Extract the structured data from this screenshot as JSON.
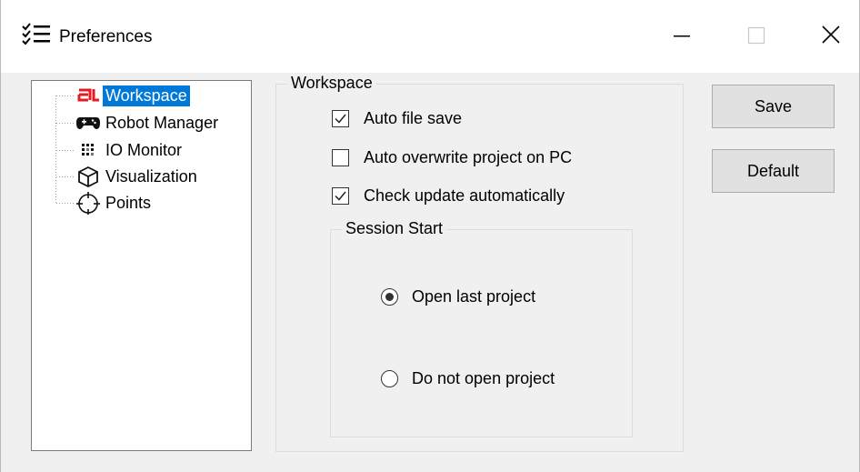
{
  "window": {
    "title": "Preferences",
    "icon": "list-settings-icon",
    "controls": {
      "minimize": "minimize-icon",
      "maximize": "maximize-icon",
      "close": "close-icon"
    }
  },
  "tree": {
    "items": [
      {
        "label": "Workspace",
        "icon": "workspace-logo-icon",
        "selected": true
      },
      {
        "label": "Robot Manager",
        "icon": "gamepad-icon",
        "selected": false
      },
      {
        "label": "IO Monitor",
        "icon": "io-grid-icon",
        "selected": false
      },
      {
        "label": "Visualization",
        "icon": "cube-icon",
        "selected": false
      },
      {
        "label": "Points",
        "icon": "crosshair-icon",
        "selected": false
      }
    ]
  },
  "workspace": {
    "legend": "Workspace",
    "options": [
      {
        "label": "Auto file save",
        "checked": true
      },
      {
        "label": "Auto overwrite project on PC",
        "checked": false
      },
      {
        "label": "Check update automatically",
        "checked": true
      }
    ],
    "session_start": {
      "legend": "Session Start",
      "options": [
        {
          "label": "Open last project",
          "selected": true
        },
        {
          "label": "Do not open project",
          "selected": false
        }
      ]
    }
  },
  "buttons": {
    "save": "Save",
    "default": "Default"
  },
  "colors": {
    "selection": "#0078d7",
    "logo_red": "#e31b23"
  }
}
